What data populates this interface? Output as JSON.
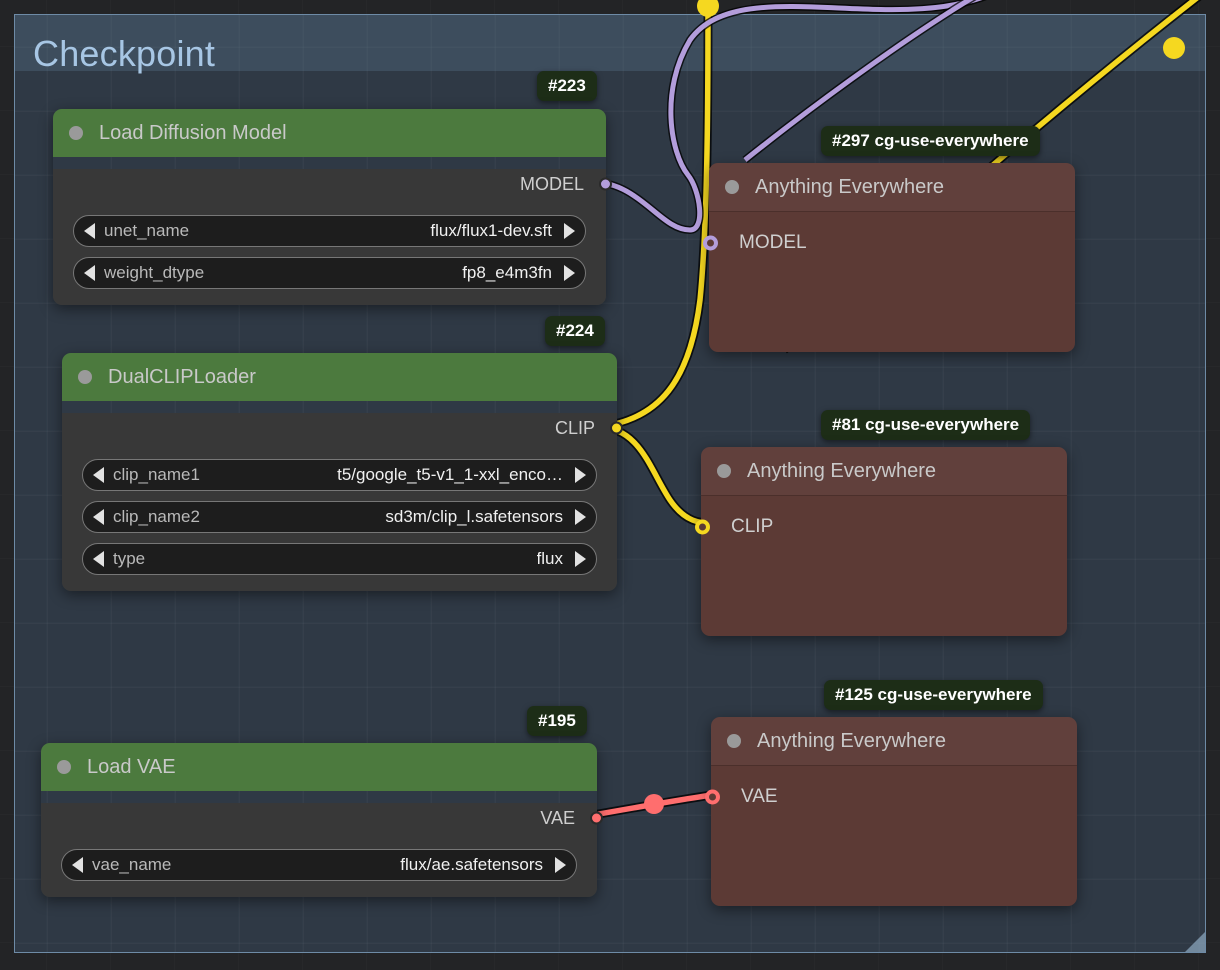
{
  "group": {
    "title": "Checkpoint",
    "color": "#3e556c",
    "border_color": "#6e8ba6"
  },
  "nodes": [
    {
      "id": "#223",
      "badge": "#223",
      "title": "Load Diffusion Model",
      "color": "#4c7a3e",
      "outputs": [
        {
          "label": "MODEL",
          "color": "#b39ddb"
        }
      ],
      "widgets": [
        {
          "name": "unet_name",
          "value": "flux/flux1-dev.sft"
        },
        {
          "name": "weight_dtype",
          "value": "fp8_e4m3fn"
        }
      ]
    },
    {
      "id": "#224",
      "badge": "#224",
      "title": "DualCLIPLoader",
      "color": "#4c7a3e",
      "outputs": [
        {
          "label": "CLIP",
          "color": "#f5d820"
        }
      ],
      "widgets": [
        {
          "name": "clip_name1",
          "value": "t5/google_t5-v1_1-xxl_enco…"
        },
        {
          "name": "clip_name2",
          "value": "sd3m/clip_l.safetensors"
        },
        {
          "name": "type",
          "value": "flux"
        }
      ]
    },
    {
      "id": "#195",
      "badge": "#195",
      "title": "Load VAE",
      "color": "#4c7a3e",
      "outputs": [
        {
          "label": "VAE",
          "color": "#ff6e6e"
        }
      ],
      "widgets": [
        {
          "name": "vae_name",
          "value": "flux/ae.safetensors"
        }
      ]
    },
    {
      "id": "#297",
      "badge": "#297 cg-use-everywhere",
      "title": "Anything Everywhere",
      "color": "#5c3a35",
      "inputs": [
        {
          "label": "MODEL",
          "color": "#b39ddb"
        }
      ]
    },
    {
      "id": "#81",
      "badge": "#81 cg-use-everywhere",
      "title": "Anything Everywhere",
      "color": "#5c3a35",
      "inputs": [
        {
          "label": "CLIP",
          "color": "#f5d820"
        }
      ]
    },
    {
      "id": "#125",
      "badge": "#125 cg-use-everywhere",
      "title": "Anything Everywhere",
      "color": "#5c3a35",
      "inputs": [
        {
          "label": "VAE",
          "color": "#ff6e6e"
        }
      ]
    }
  ],
  "links": [
    {
      "name": "model-link",
      "color": "#b39ddb"
    },
    {
      "name": "clip-link",
      "color": "#f5d820"
    },
    {
      "name": "vae-link",
      "color": "#ff6e6e"
    },
    {
      "name": "clip-up-link",
      "color": "#f5d820"
    },
    {
      "name": "clip-diagonal-link",
      "color": "#f5d820"
    }
  ]
}
